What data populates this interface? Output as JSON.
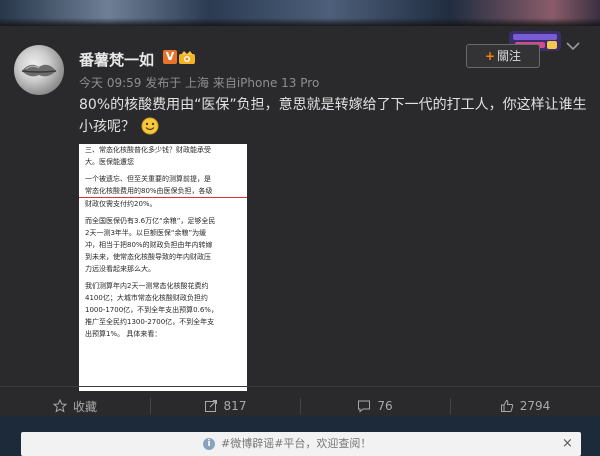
{
  "post": {
    "username": "番薯梵一如",
    "v_badge": "V",
    "meta": "今天 09:59 发布于 上海 来自iPhone 13 Pro",
    "follow_plus": "+",
    "follow_label": "關注",
    "text": "80%的核酸费用由“医保”负担，意思就是转嫁给了下一代的打工人，你这样让谁生小孩呢？"
  },
  "image_text": {
    "lines": [
      "三、常态化核酸普化多少钱？财政能承受",
      "大。医保能遭您",
      "",
      "一个被遗忘、但至关重要的测算前提，是",
      "常态化核酸费用的80%由医保负担，各级",
      "财政仅需支付约20%。",
      "",
      "而全国医保仍有3.6万亿“余粮”，足够全民",
      "2天一测3年半。以巨额医保“余粮”为缓",
      "冲，相当于把80%的财政负担由年内转嫁",
      "到未来，使常态化核酸导致的年内财政压",
      "力远没看起来那么大。",
      "",
      "我们测算年内2天一测常态化核酸花费约",
      "4100亿；大城市常态化核酸财政负担约",
      "1000-1700亿，不到全年支出预算0.6%，",
      "推广至全民约1300-2700亿，不到全年支",
      "出预算1%。 具体来看："
    ]
  },
  "actions": {
    "favorite": "收藏",
    "repost": "817",
    "comment": "76",
    "like": "2794"
  },
  "notification": {
    "text": "#微博辟谣#平台，欢迎查阅！",
    "close": "×"
  }
}
